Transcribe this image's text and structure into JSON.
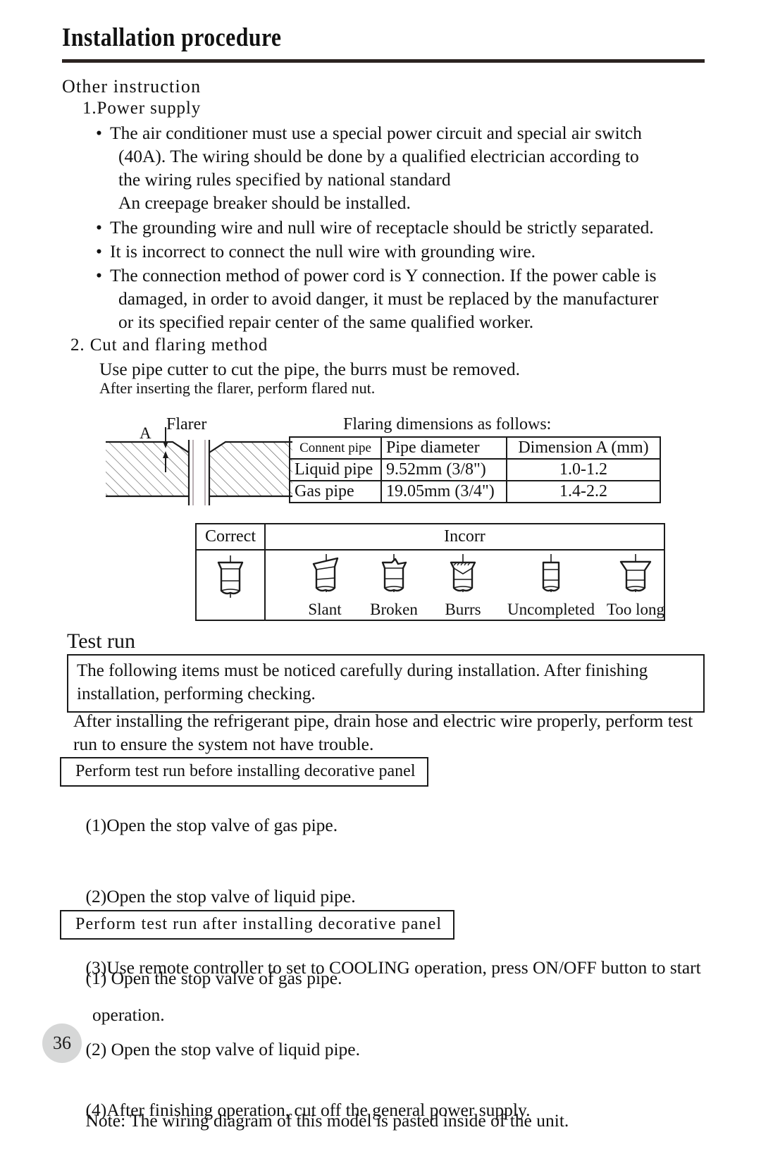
{
  "page": {
    "title": "Installation procedure",
    "number": "36"
  },
  "other_instruction": {
    "heading": "Other instruction",
    "subheading": "1.Power supply",
    "bullets": [
      {
        "lines": [
          "The air conditioner must use a special power circuit and special air switch",
          "(40A). The wiring should be done by a qualified electrician according to",
          "the wiring rules specified by national standard",
          "An creepage breaker should be installed."
        ]
      },
      {
        "lines": [
          "The grounding wire and null wire of receptacle should be strictly separated."
        ]
      },
      {
        "lines": [
          "It is incorrect to connect the null wire with grounding wire."
        ]
      },
      {
        "lines": [
          "The connection method of power cord is Y connection. If the power cable is",
          "damaged, in order to avoid danger, it must be replaced by the manufacturer",
          "or its specified repair center of the same qualified worker."
        ]
      }
    ],
    "bullet_marker": "•"
  },
  "cut_and_flaring": {
    "heading": "2. Cut and flaring method",
    "line1": "Use pipe cutter to cut the pipe, the burrs must be removed.",
    "line2": "After inserting the flarer, perform flared nut.",
    "figure_caption": "Flarer",
    "figure_dimension_label": "A",
    "table_caption": "Flaring dimensions as follows:",
    "table": {
      "headers": [
        "Connent pipe",
        "Pipe diameter",
        "Dimension A (mm)"
      ],
      "rows": [
        [
          "Liquid pipe",
          "9.52mm (3/8\")",
          "1.0-1.2"
        ],
        [
          "Gas pipe",
          "19.05mm (3/4\")",
          "1.4-2.2"
        ]
      ]
    },
    "quality_table": {
      "correct_header": "Correct",
      "incorrect_header": "Incorr",
      "incorrect_labels": [
        "Slant",
        "Broken",
        "Burrs",
        "Uncompleted",
        "Too long"
      ]
    }
  },
  "test_run": {
    "heading": "Test run",
    "notice": "The following items must be noticed carefully during installation. After finishing installation, performing checking.",
    "intro": "After installing the refrigerant pipe, drain hose and electric wire properly, perform test run to ensure the system not have trouble.",
    "before_panel": {
      "band": "Perform test run before installing decorative panel",
      "steps": [
        {
          "text": "(1)Open the stop valve of gas pipe.",
          "sub": ""
        },
        {
          "text": "(2)Open the stop valve of liquid pipe.",
          "sub": ""
        },
        {
          "text": "(3)Use remote controller to set to COOLING operation, press ON/OFF button to start",
          "sub": "operation."
        },
        {
          "text": "(4)After finishing operation, cut off the general power supply.",
          "sub": ""
        }
      ]
    },
    "after_panel": {
      "band": "Perform test run after installing decorative panel",
      "steps": [
        {
          "text": "(1) Open the stop valve of gas pipe.",
          "sub": ""
        },
        {
          "text": "(2) Open the stop valve of liquid pipe.",
          "sub": ""
        },
        {
          "text": "Note: The wiring diagram of this model is pasted inside of the unit.",
          "sub": ""
        }
      ]
    }
  },
  "colors": {
    "ink": "#111111",
    "rule": "#2b2320",
    "page_badge_bg": "#d6d7d7"
  }
}
